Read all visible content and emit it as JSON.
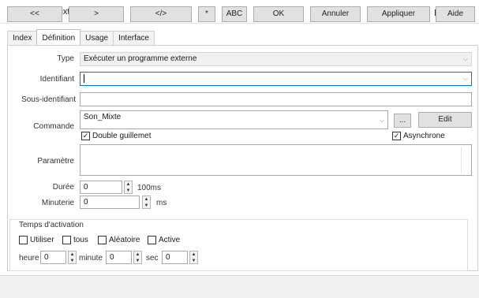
{
  "window": {
    "title": "Action Son_Mixte",
    "maximize_label": "",
    "close_label": "×"
  },
  "tabs": [
    {
      "label": "Index"
    },
    {
      "label": "Définition",
      "active": true
    },
    {
      "label": "Usage"
    },
    {
      "label": "Interface"
    }
  ],
  "form": {
    "type_label": "Type",
    "type_value": "Exécuter un programme externe",
    "identifiant_label": "Identifiant",
    "identifiant_value": "",
    "sous_identifiant_label": "Sous-identifiant",
    "sous_identifiant_value": "",
    "commande_label": "Commande",
    "commande_value": "Son_Mixte",
    "browse_label": "...",
    "edit_label": "Edit",
    "double_guillemet_label": "Double guillemet",
    "double_guillemet_checked": true,
    "asynchrone_label": "Asynchrone",
    "asynchrone_checked": true,
    "parametre_label": "Paramètre",
    "parametre_value": "",
    "duree_label": "Durée",
    "duree_value": "0",
    "duree_unit": "100ms",
    "minuterie_label": "Minuterie",
    "minuterie_value": "0",
    "minuterie_unit": "ms"
  },
  "activation": {
    "group_label": "Temps d'activation",
    "utiliser_label": "Utiliser",
    "tous_label": "tous",
    "aleatoire_label": "Aléatoire",
    "active_label": "Active",
    "heure_label": "heure",
    "heure_value": "0",
    "minute_label": "minute",
    "minute_value": "0",
    "sec_label": "sec",
    "sec_value": "0"
  },
  "bottom_buttons": [
    {
      "label": "<<"
    },
    {
      "label": ">"
    },
    {
      "label": "</>"
    },
    {
      "label": "*"
    },
    {
      "label": "ABC"
    },
    {
      "label": "OK"
    },
    {
      "label": "Annuler"
    },
    {
      "label": "Appliquer"
    },
    {
      "label": "Aide"
    }
  ]
}
